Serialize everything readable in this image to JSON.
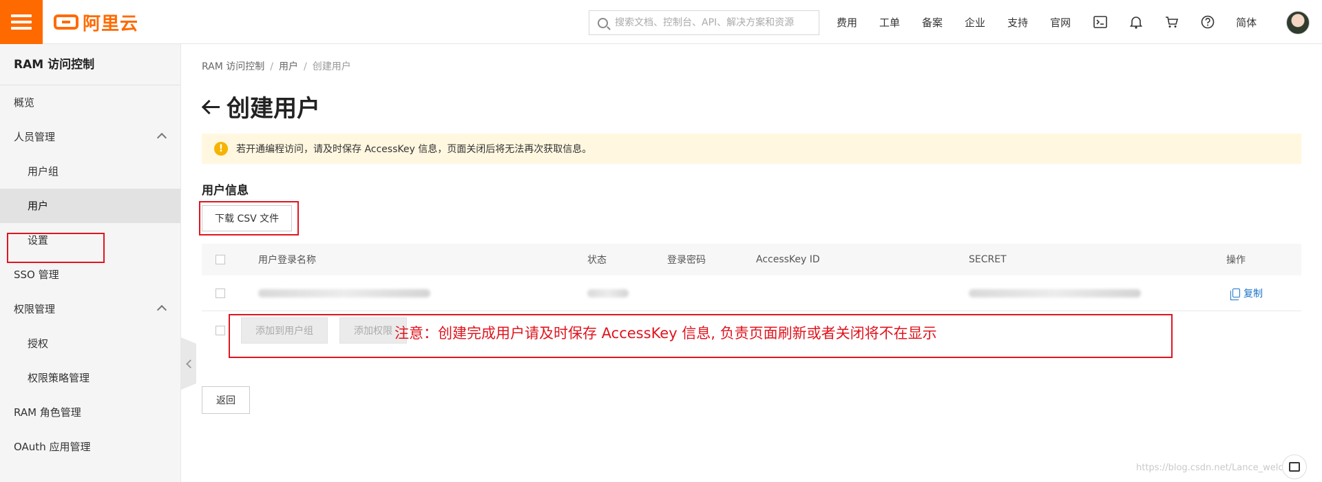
{
  "header": {
    "logo_text": "阿里云",
    "search_placeholder": "搜索文档、控制台、API、解决方案和资源",
    "nav": [
      "费用",
      "工单",
      "备案",
      "企业",
      "支持",
      "官网"
    ],
    "lang": "简体",
    "icons": [
      "terminal-icon",
      "bell-icon",
      "cart-icon",
      "help-icon"
    ]
  },
  "sidebar": {
    "title": "RAM 访问控制",
    "items": [
      {
        "label": "概览",
        "level": 0
      },
      {
        "label": "人员管理",
        "level": 0,
        "expanded": true
      },
      {
        "label": "用户组",
        "level": 1
      },
      {
        "label": "用户",
        "level": 1,
        "active": true
      },
      {
        "label": "设置",
        "level": 1
      },
      {
        "label": "SSO 管理",
        "level": 0
      },
      {
        "label": "权限管理",
        "level": 0,
        "expanded": true
      },
      {
        "label": "授权",
        "level": 1
      },
      {
        "label": "权限策略管理",
        "level": 1
      },
      {
        "label": "RAM 角色管理",
        "level": 0
      },
      {
        "label": "OAuth 应用管理",
        "level": 0
      }
    ]
  },
  "breadcrumb": [
    "RAM 访问控制",
    "用户",
    "创建用户"
  ],
  "page_title": "创建用户",
  "alert_text": "若开通编程访问，请及时保存 AccessKey 信息，页面关闭后将无法再次获取信息。",
  "section_title": "用户信息",
  "download_csv": "下载 CSV 文件",
  "table": {
    "columns": [
      "用户登录名称",
      "状态",
      "登录密码",
      "AccessKey ID",
      "SECRET",
      "操作"
    ],
    "copy_label": "复制"
  },
  "annotation": "注意：创建完成用户请及时保存 AccessKey 信息, 负责页面刷新或者关闭将不在显示",
  "actions": {
    "add_to_group": "添加到用户组",
    "add_permission": "添加权限",
    "back": "返回"
  },
  "watermark": "https://blog.csdn.net/Lance_welcome",
  "colors": {
    "brand": "#ff6a00",
    "link": "#1a73c8",
    "annotation": "#e0141e",
    "alert_bg": "#fff7e0"
  }
}
